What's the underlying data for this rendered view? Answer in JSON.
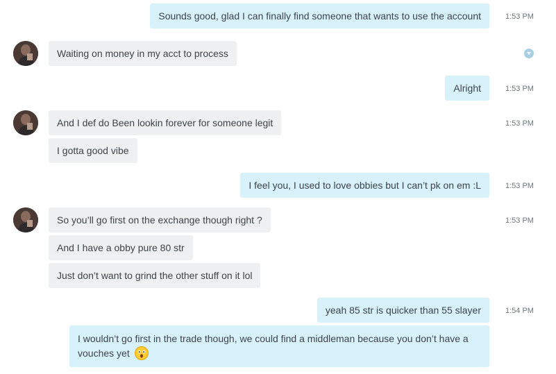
{
  "messages": {
    "m1": {
      "text": "Sounds good, glad I can finally find someone that wants to use the account",
      "time": "1:53 PM"
    },
    "m2": {
      "text": "Waiting on money in my acct to process"
    },
    "m3": {
      "text": "Alright",
      "time": "1:53 PM"
    },
    "m4": {
      "text": "And I def do Been lookin forever for someone legit",
      "time": "1:53 PM"
    },
    "m5": {
      "text": "I gotta good vibe"
    },
    "m6": {
      "text": "I feel you, I used to love obbies but I can’t pk on em :L",
      "time": "1:53 PM"
    },
    "m7": {
      "text": "So you’ll go first on the exchange though right ?",
      "time": "1:53 PM"
    },
    "m8": {
      "text": "And I have a obby pure 80 str"
    },
    "m9": {
      "text": "Just don’t want to grind the other stuff on it lol"
    },
    "m10": {
      "text": "yeah 85 str is quicker than 55 slayer",
      "time": "1:54 PM"
    },
    "m11": {
      "text": "I wouldn’t go first in the trade though, we could find a middleman because you don’t have a vouches yet",
      "emoji": "astonished-face"
    }
  },
  "icons": {
    "status": "delivery-status-chevron",
    "avatar": "contact-avatar"
  },
  "colors": {
    "incoming_bubble": "#eef0f2",
    "outgoing_bubble": "#d8f2fb",
    "text": "#3d4348",
    "time": "#6d7479"
  }
}
